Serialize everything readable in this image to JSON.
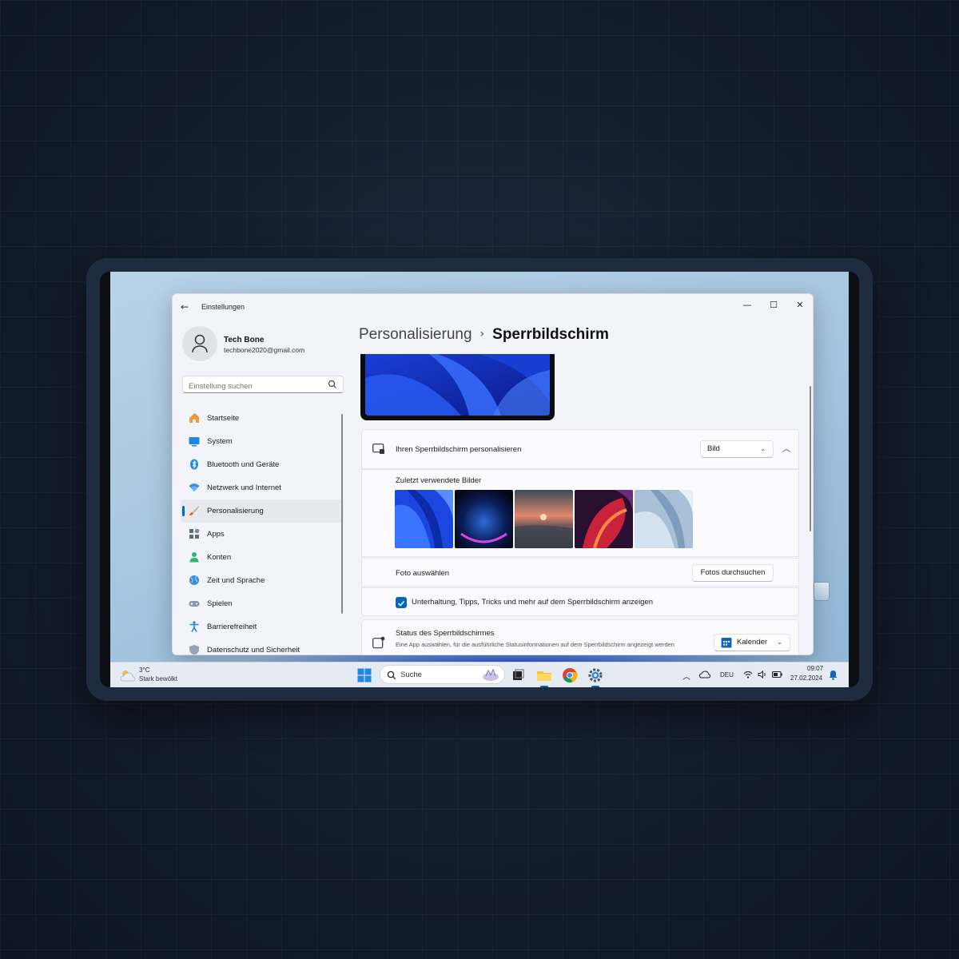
{
  "window": {
    "title": "Einstellungen",
    "controls": {
      "minimize": "—",
      "maximize": "☐",
      "close": "✕"
    },
    "back_icon": "←"
  },
  "user": {
    "name": "Tech Bone",
    "email": "techbone2020@gmail.com"
  },
  "search": {
    "placeholder": "Einstellung suchen"
  },
  "nav": {
    "items": [
      {
        "label": "Startseite",
        "icon": "home-icon"
      },
      {
        "label": "System",
        "icon": "display-icon"
      },
      {
        "label": "Bluetooth und Geräte",
        "icon": "bluetooth-icon"
      },
      {
        "label": "Netzwerk und Internet",
        "icon": "wifi-icon"
      },
      {
        "label": "Personalisierung",
        "icon": "brush-icon",
        "active": true
      },
      {
        "label": "Apps",
        "icon": "apps-icon"
      },
      {
        "label": "Konten",
        "icon": "person-icon"
      },
      {
        "label": "Zeit und Sprache",
        "icon": "globe-icon"
      },
      {
        "label": "Spielen",
        "icon": "gamepad-icon"
      },
      {
        "label": "Barrierefreiheit",
        "icon": "accessibility-icon"
      },
      {
        "label": "Datenschutz und Sicherheit",
        "icon": "shield-icon"
      }
    ]
  },
  "breadcrumb": {
    "parent": "Personalisierung",
    "separator": "›",
    "current": "Sperrbildschirm"
  },
  "lockscreen": {
    "personalize_label": "Ihren Sperrbildschirm personalisieren",
    "personalize_value": "Bild",
    "recent_label": "Zuletzt verwendete Bilder",
    "photo_label": "Foto auswählen",
    "browse_button": "Fotos durchsuchen",
    "tips_checkbox_label": "Unterhaltung, Tipps, Tricks und mehr auf dem Sperrbildschirm anzeigen",
    "tips_checked": true,
    "status_title": "Status des Sperrbildschirmes",
    "status_desc": "Eine App auswählen, für die ausführliche Statusinformationen auf dem Sperrbildschirm angezeigt werden",
    "status_value": "Kalender"
  },
  "taskbar": {
    "weather_temp": "3°C",
    "weather_cond": "Stark bewölkt",
    "search_label": "Suche",
    "language": "DEU",
    "time": "09:07",
    "date": "27.02.2024"
  },
  "colors": {
    "accent": "#0067c0",
    "window_bg": "#f3f4f9",
    "card_bg": "#fbfbfd"
  }
}
